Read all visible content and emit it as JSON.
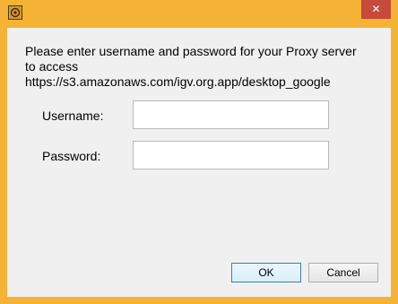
{
  "dialog": {
    "message_lines": [
      "Please enter username and password for your Proxy server",
      "to access",
      "https://s3.amazonaws.com/igv.org.app/desktop_google"
    ],
    "username_label": "Username:",
    "username_value": "",
    "password_label": "Password:",
    "password_value": "",
    "ok_label": "OK",
    "cancel_label": "Cancel",
    "close_glyph": "✕"
  },
  "icons": {
    "app": "igv-app-icon",
    "close": "close-icon"
  },
  "colors": {
    "titlebar": "#f5b335",
    "close_button": "#c7493a",
    "client_bg": "#f0f0f0",
    "ok_border": "#3c7fb1"
  }
}
